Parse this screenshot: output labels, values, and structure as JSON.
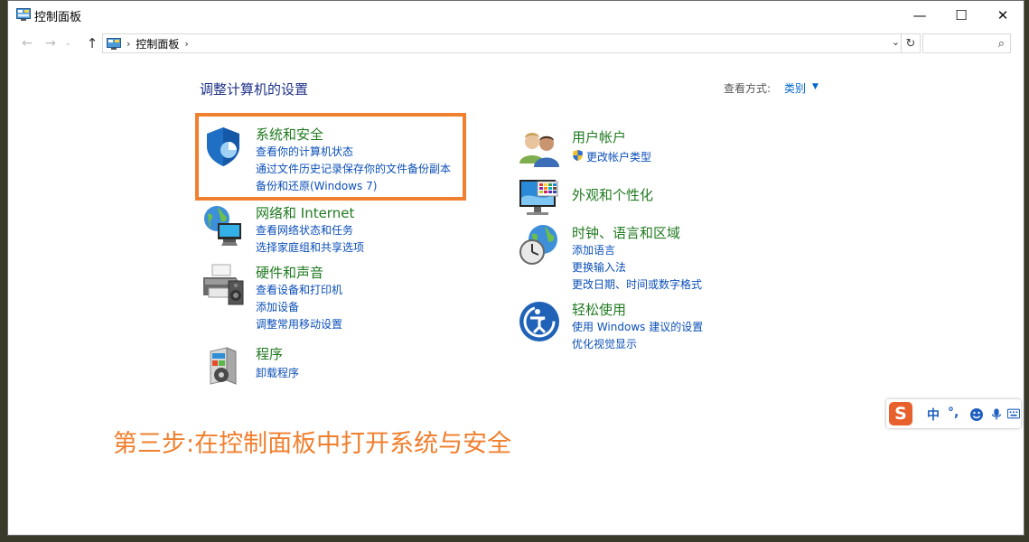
{
  "window": {
    "title": "控制面板",
    "minimize_glyph": "—",
    "maximize_glyph": "☐",
    "close_glyph": "✕"
  },
  "nav": {
    "back_glyph": "←",
    "forward_glyph": "→",
    "recent_glyph": "⌄",
    "up_glyph": "↑",
    "address_separator": "›",
    "address_path": "控制面板",
    "address_dropdown_glyph": "⌄",
    "refresh_glyph": "↻",
    "search_placeholder": "",
    "search_glyph": "⌕"
  },
  "main": {
    "heading": "调整计算机的设置",
    "view_by_label": "查看方式:",
    "view_by_value": "类别",
    "view_by_caret": "▼"
  },
  "categories": {
    "system_security": {
      "title": "系统和安全",
      "links": [
        "查看你的计算机状态",
        "通过文件历史记录保存你的文件备份副本",
        "备份和还原(Windows 7)"
      ]
    },
    "network": {
      "title": "网络和 Internet",
      "links": [
        "查看网络状态和任务",
        "选择家庭组和共享选项"
      ]
    },
    "hardware_sound": {
      "title": "硬件和声音",
      "links": [
        "查看设备和打印机",
        "添加设备",
        "调整常用移动设置"
      ]
    },
    "programs": {
      "title": "程序",
      "links": [
        "卸载程序"
      ]
    },
    "user_accounts": {
      "title": "用户帐户",
      "links": [
        "更改帐户类型"
      ]
    },
    "appearance": {
      "title": "外观和个性化",
      "links": []
    },
    "clock_region": {
      "title": "时钟、语言和区域",
      "links": [
        "添加语言",
        "更换输入法",
        "更改日期、时间或数字格式"
      ]
    },
    "ease_of_access": {
      "title": "轻松使用",
      "links": [
        "使用 Windows 建议的设置",
        "优化视觉显示"
      ]
    }
  },
  "annotation": {
    "note": "第三步:在控制面板中打开系统与安全",
    "highlight_color": "#f07f2e"
  },
  "ime_toolbar": {
    "logo": "S",
    "mode": "中",
    "punct": "°,"
  },
  "colors": {
    "heading": "#1e3287",
    "category_title": "#207a20",
    "link": "#0b4fb8"
  }
}
